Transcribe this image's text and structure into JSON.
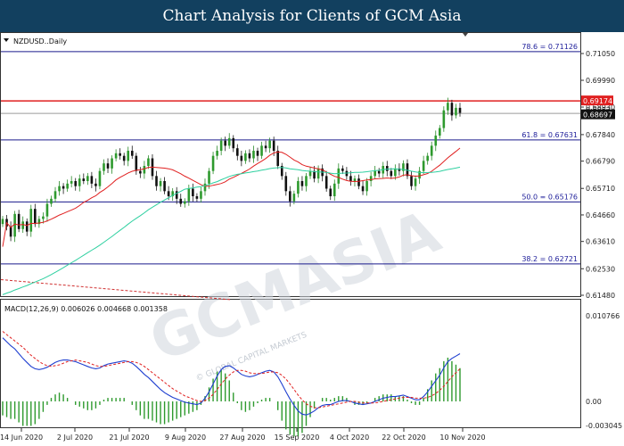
{
  "banner": {
    "title": "Chart Analysis for Clients of GCM Asia"
  },
  "chart_data": {
    "type": "candlestick",
    "symbol_label": "NZDUSD..Daily",
    "price_axis": {
      "ticks": [
        "0.71050",
        "0.69990",
        "0.68930",
        "0.67840",
        "0.66790",
        "0.65710",
        "0.64660",
        "0.63610",
        "0.62530",
        "0.61480"
      ],
      "range": [
        0.6135,
        0.715
      ]
    },
    "x_axis": {
      "ticks": [
        "14 Jun 2020",
        "2 Jul 2020",
        "21 Jul 2020",
        "9 Aug 2020",
        "27 Aug 2020",
        "15 Sep 2020",
        "4 Oct 2020",
        "22 Oct 2020",
        "10 Nov 2020"
      ]
    },
    "current_price": {
      "label": "0.68697",
      "value": 0.68697
    },
    "red_level": {
      "label": "0.69174",
      "value": 0.69174,
      "color": "#e02020"
    },
    "gray_level_label": "0.6852",
    "fib_levels": [
      {
        "label": "78.6 = 0.71126",
        "value": 0.71126
      },
      {
        "label": "61.8 = 0.67631",
        "value": 0.67631
      },
      {
        "label": "50.0 = 0.65176",
        "value": 0.65176
      },
      {
        "label": "38.2 = 0.62721",
        "value": 0.62721
      }
    ],
    "closes": [
      0.645,
      0.642,
      0.638,
      0.647,
      0.641,
      0.644,
      0.64,
      0.649,
      0.643,
      0.645,
      0.646,
      0.651,
      0.653,
      0.656,
      0.658,
      0.657,
      0.659,
      0.66,
      0.658,
      0.661,
      0.66,
      0.662,
      0.659,
      0.658,
      0.664,
      0.667,
      0.665,
      0.669,
      0.671,
      0.67,
      0.668,
      0.672,
      0.67,
      0.664,
      0.663,
      0.666,
      0.669,
      0.662,
      0.658,
      0.66,
      0.656,
      0.654,
      0.656,
      0.653,
      0.651,
      0.652,
      0.657,
      0.654,
      0.653,
      0.656,
      0.659,
      0.664,
      0.67,
      0.672,
      0.676,
      0.674,
      0.677,
      0.673,
      0.67,
      0.668,
      0.671,
      0.669,
      0.672,
      0.67,
      0.674,
      0.673,
      0.676,
      0.672,
      0.666,
      0.662,
      0.656,
      0.652,
      0.655,
      0.66,
      0.658,
      0.662,
      0.664,
      0.661,
      0.665,
      0.662,
      0.657,
      0.654,
      0.659,
      0.665,
      0.664,
      0.662,
      0.66,
      0.661,
      0.658,
      0.656,
      0.66,
      0.662,
      0.664,
      0.663,
      0.666,
      0.664,
      0.662,
      0.665,
      0.664,
      0.667,
      0.662,
      0.658,
      0.661,
      0.664,
      0.668,
      0.67,
      0.674,
      0.678,
      0.681,
      0.688,
      0.691,
      0.686,
      0.689,
      0.687
    ],
    "ma_red_start": 0.634,
    "ma_red_end": 0.68,
    "ma_green_start": 0.615,
    "ma_green_end": 0.667,
    "downtrend_line": {
      "from": 0.621,
      "to": 0.613
    },
    "macd": {
      "label": "MACD(12,26,9) 0.006026 0.004668 0.001358",
      "axis_ticks": [
        "0.010766",
        "0.00",
        "-0.003045"
      ],
      "range": [
        -0.0034,
        0.011
      ],
      "main": [
        0.008,
        0.0075,
        0.007,
        0.0066,
        0.006,
        0.0054,
        0.0049,
        0.0044,
        0.0041,
        0.004,
        0.0041,
        0.0043,
        0.0046,
        0.0049,
        0.0051,
        0.0052,
        0.0052,
        0.0051,
        0.005,
        0.0048,
        0.0046,
        0.0044,
        0.0042,
        0.0041,
        0.0042,
        0.0045,
        0.0047,
        0.0048,
        0.0049,
        0.005,
        0.0051,
        0.005,
        0.0048,
        0.0044,
        0.0039,
        0.0034,
        0.003,
        0.0025,
        0.002,
        0.0015,
        0.0011,
        0.0008,
        0.0005,
        0.0003,
        0.0001,
        -0.0001,
        -0.0002,
        -0.0003,
        -0.0004,
        -0.0002,
        0.0004,
        0.0012,
        0.0022,
        0.0032,
        0.004,
        0.0044,
        0.0045,
        0.0042,
        0.0038,
        0.0034,
        0.0032,
        0.0031,
        0.0032,
        0.0034,
        0.0036,
        0.0038,
        0.0039,
        0.0037,
        0.0031,
        0.0022,
        0.0012,
        0.0003,
        -0.0005,
        -0.0012,
        -0.0016,
        -0.0017,
        -0.0015,
        -0.0012,
        -0.0008,
        -0.0005,
        -0.0004,
        -0.0004,
        -0.0002,
        0.0,
        0.0001,
        0.0001,
        0.0,
        -0.0002,
        -0.0003,
        -0.0004,
        -0.0003,
        -0.0002,
        0.0,
        0.0002,
        0.0004,
        0.0005,
        0.0006,
        0.0006,
        0.0007,
        0.0008,
        0.0006,
        0.0004,
        0.0002,
        0.0002,
        0.0006,
        0.0012,
        0.0019,
        0.0026,
        0.0033,
        0.0042,
        0.005,
        0.0054,
        0.0057,
        0.006
      ],
      "signal": [
        0.0088,
        0.0084,
        0.008,
        0.0076,
        0.0072,
        0.0068,
        0.0063,
        0.0058,
        0.0054,
        0.005,
        0.0047,
        0.0045,
        0.0044,
        0.0045,
        0.0046,
        0.0048,
        0.005,
        0.0051,
        0.0052,
        0.0051,
        0.005,
        0.0049,
        0.0047,
        0.0045,
        0.0044,
        0.0044,
        0.0045,
        0.0046,
        0.0047,
        0.0048,
        0.0049,
        0.005,
        0.005,
        0.0049,
        0.0047,
        0.0044,
        0.004,
        0.0036,
        0.0032,
        0.0028,
        0.0024,
        0.002,
        0.0016,
        0.0013,
        0.001,
        0.0007,
        0.0005,
        0.0003,
        0.0001,
        0.0,
        0.0001,
        0.0004,
        0.0009,
        0.0015,
        0.0022,
        0.0028,
        0.0033,
        0.0037,
        0.0039,
        0.0039,
        0.0038,
        0.0036,
        0.0035,
        0.0035,
        0.0035,
        0.0036,
        0.0037,
        0.0037,
        0.0036,
        0.0033,
        0.0028,
        0.0022,
        0.0015,
        0.0008,
        0.0002,
        -0.0003,
        -0.0006,
        -0.0008,
        -0.0008,
        -0.0007,
        -0.0006,
        -0.0005,
        -0.0004,
        -0.0003,
        -0.0002,
        -0.0001,
        0.0,
        0.0,
        -0.0001,
        -0.0002,
        -0.0002,
        -0.0002,
        -0.0002,
        -0.0001,
        0.0,
        0.0001,
        0.0002,
        0.0003,
        0.0004,
        0.0005,
        0.0005,
        0.0005,
        0.0004,
        0.0004,
        0.0004,
        0.0005,
        0.0007,
        0.001,
        0.0014,
        0.0019,
        0.0025,
        0.0031,
        0.0036,
        0.0041
      ]
    }
  },
  "watermark": {
    "text": "GCMASIA",
    "subtext": "© GLOBAL CAPITAL MARKETS"
  }
}
